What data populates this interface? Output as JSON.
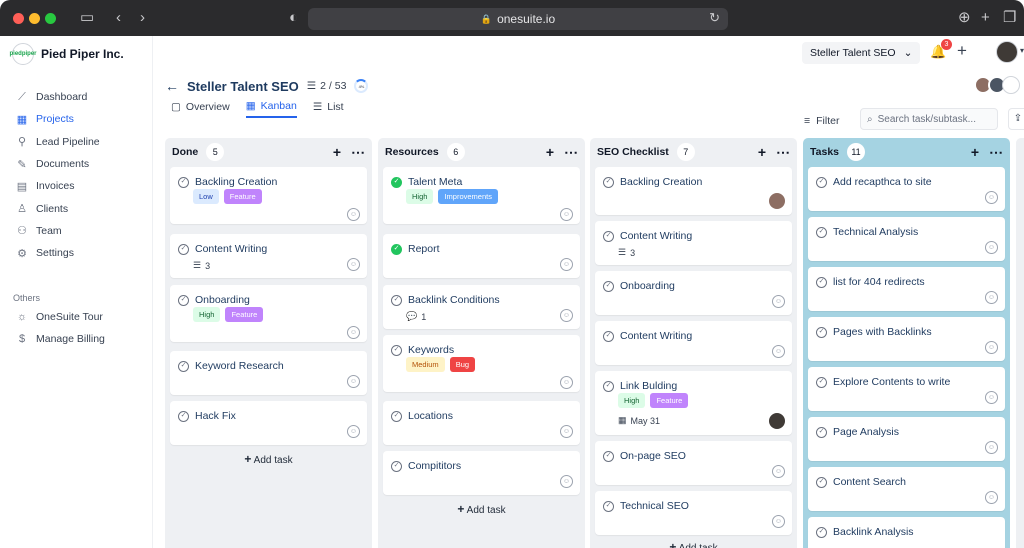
{
  "browser": {
    "url": "onesuite.io"
  },
  "org": {
    "name": "Pied Piper Inc.",
    "logo_text": "piedpiper"
  },
  "nav": [
    {
      "label": "Dashboard",
      "icon": "chart-line-icon"
    },
    {
      "label": "Projects",
      "icon": "projects-icon"
    },
    {
      "label": "Lead Pipeline",
      "icon": "lead-pipeline-icon"
    },
    {
      "label": "Documents",
      "icon": "document-icon"
    },
    {
      "label": "Invoices",
      "icon": "invoice-icon"
    },
    {
      "label": "Clients",
      "icon": "clients-icon"
    },
    {
      "label": "Team",
      "icon": "team-icon"
    },
    {
      "label": "Settings",
      "icon": "gear-icon"
    }
  ],
  "others": {
    "label": "Others",
    "items": [
      {
        "label": "OneSuite Tour",
        "icon": "sun-icon"
      },
      {
        "label": "Manage Billing",
        "icon": "dollar-icon"
      }
    ]
  },
  "header": {
    "project_select": "Steller Talent SEO",
    "notifications": "3"
  },
  "project": {
    "title": "Steller Talent SEO",
    "counter": "2 / 53",
    "progress": "4%"
  },
  "tabs": [
    {
      "label": "Overview"
    },
    {
      "label": "Kanban"
    },
    {
      "label": "List"
    }
  ],
  "toolbar": {
    "filter": "Filter",
    "search_placeholder": "Search task/subtask..."
  },
  "add_task_label": "Add task",
  "columns": [
    {
      "name": "Done",
      "count": "5",
      "cards": [
        {
          "title": "Backling Creation",
          "tags": [
            {
              "text": "Low"
            },
            {
              "text": "Feature"
            }
          ]
        },
        {
          "title": "Content Writing",
          "subtasks": "3"
        },
        {
          "title": "Onboarding",
          "tags": [
            {
              "text": "High"
            },
            {
              "text": "Feature"
            }
          ]
        },
        {
          "title": "Keyword Research"
        },
        {
          "title": "Hack Fix"
        }
      ]
    },
    {
      "name": "Resources",
      "count": "6",
      "cards": [
        {
          "title": "Talent Meta",
          "tags": [
            {
              "text": "High"
            },
            {
              "text": "Improvements"
            }
          ]
        },
        {
          "title": "Report"
        },
        {
          "title": "Backlink Conditions",
          "comments": "1"
        },
        {
          "title": "Keywords",
          "tags": [
            {
              "text": "Medium"
            },
            {
              "text": "Bug"
            }
          ]
        },
        {
          "title": "Locations"
        },
        {
          "title": "Compititors"
        }
      ]
    },
    {
      "name": "SEO Checklist",
      "count": "7",
      "cards": [
        {
          "title": "Backling Creation"
        },
        {
          "title": "Content Writing",
          "subtasks": "3"
        },
        {
          "title": "Onboarding"
        },
        {
          "title": "Content Writing"
        },
        {
          "title": "Link Bulding",
          "tags": [
            {
              "text": "High"
            },
            {
              "text": "Feature"
            }
          ],
          "due": "May 31"
        },
        {
          "title": "On-page SEO"
        },
        {
          "title": "Technical SEO"
        }
      ]
    },
    {
      "name": "Tasks",
      "count": "11",
      "cards": [
        {
          "title": "Add recapthca to site"
        },
        {
          "title": "Technical Analysis"
        },
        {
          "title": "list for 404 redirects"
        },
        {
          "title": "Pages with Backlinks"
        },
        {
          "title": "Explore Contents to write"
        },
        {
          "title": "Page Analysis"
        },
        {
          "title": "Content Search"
        },
        {
          "title": "Backlink Analysis"
        }
      ]
    }
  ]
}
